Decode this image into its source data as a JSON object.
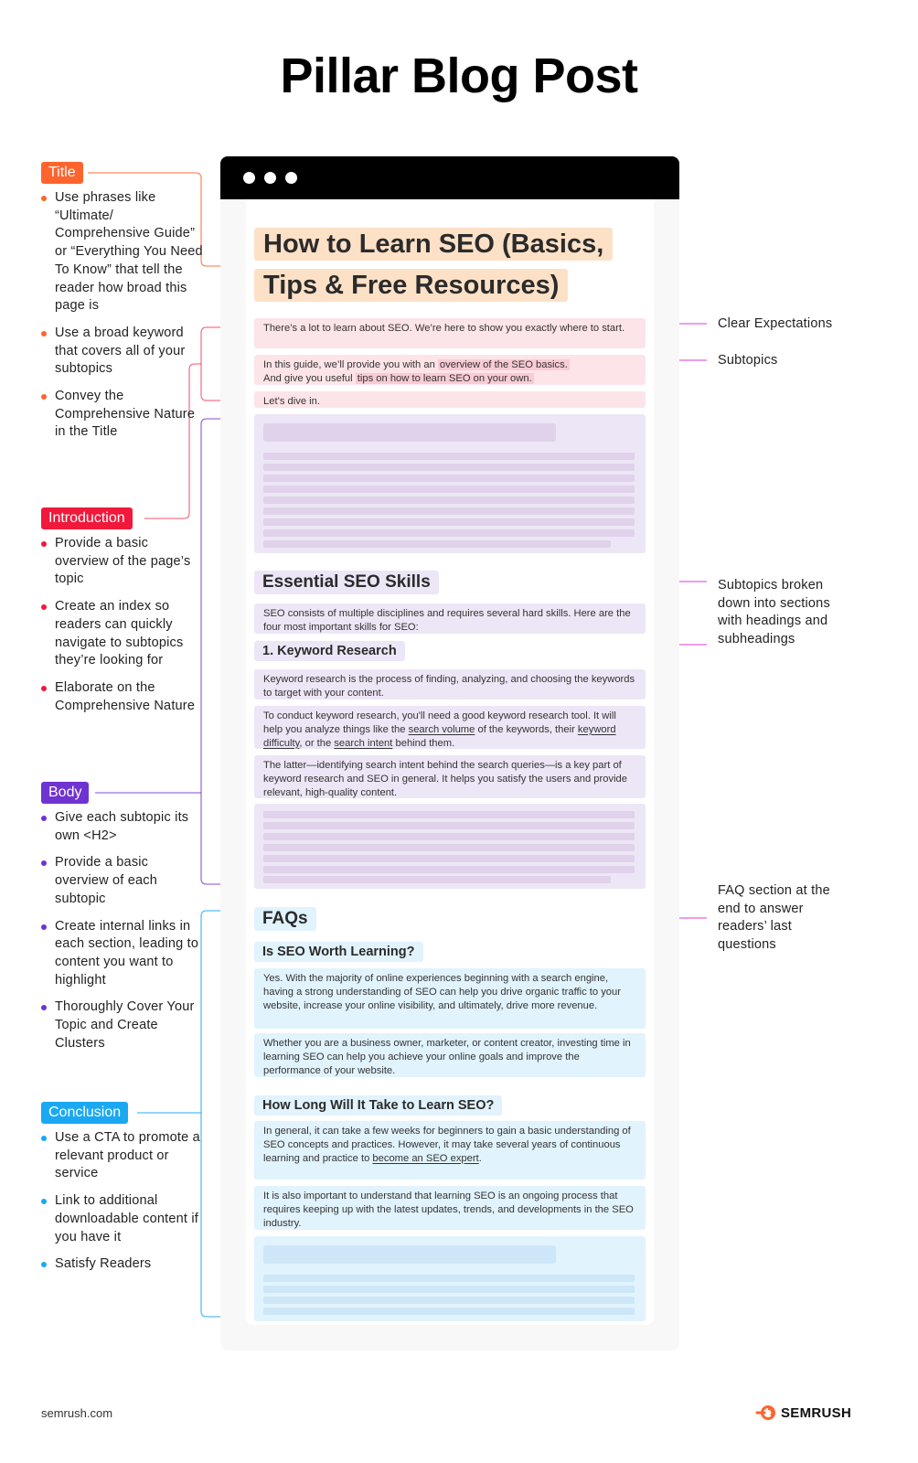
{
  "title": "Pillar Blog Post",
  "colors": {
    "title": "#ff642d",
    "introduction": "#f0193c",
    "body": "#6f33d1",
    "conclusion": "#1ba8f2",
    "annotation": "#d91fd6"
  },
  "left_sections": [
    {
      "badge": "Title",
      "bullets": [
        "Use phrases like “Ultimate/ Comprehensive Guide” or “Everything You Need To Know” that tell the reader how broad this page is",
        "Use a broad keyword that covers all of your subtopics",
        "Convey the Comprehensive Nature in the Title"
      ]
    },
    {
      "badge": "Introduction",
      "bullets": [
        "Provide a basic overview of the page’s topic",
        "Create an index so readers can quickly navigate to subtopics they’re looking for",
        "Elaborate on the Comprehensive Nature"
      ]
    },
    {
      "badge": "Body",
      "bullets": [
        "Give each subtopic its own <H2>",
        "Provide a basic overview of each subtopic",
        "Create internal links in each section, leading to content you want to highlight",
        "Thoroughly Cover Your Topic and Create Clusters"
      ]
    },
    {
      "badge": "Conclusion",
      "bullets": [
        "Use a CTA to promote a relevant product or service",
        "Link to additional downloadable content if you have it",
        "Satisfy Readers"
      ]
    }
  ],
  "article": {
    "title_line1": "How to Learn SEO (Basics,",
    "title_line2": "Tips & Free Resources)",
    "intro_p1": "There’s a lot to learn about SEO. We’re here to show you exactly where to start.",
    "intro_p2_a": "In this guide, we’ll provide you with an ",
    "intro_p2_hl1": "overview of the SEO basics.",
    "intro_p2_b": "And give you useful ",
    "intro_p2_hl2": "tips on how to learn SEO on your own.",
    "intro_p3": "Let’s dive in.",
    "h2_skills": "Essential SEO Skills",
    "skills_p1": "SEO consists of multiple disciplines and requires several hard skills. Here are the four most important skills for SEO:",
    "h3_keyword": "1. Keyword Research",
    "kw_p1": "Keyword research is the process of finding, analyzing, and choosing the keywords to target with your content.",
    "kw_p2_a": "To conduct keyword research, you'll need a good keyword research tool. It will help you analyze things like the ",
    "kw_p2_link1": "search volume",
    "kw_p2_b": " of the keywords, their ",
    "kw_p2_link2": "keyword difficulty",
    "kw_p2_c": ", or the ",
    "kw_p2_link3": "search intent",
    "kw_p2_d": " behind them.",
    "kw_p3": "The latter—identifying search intent behind the search queries—is a key part of keyword research and SEO in general. It helps you satisfy the users and provide relevant, high-quality content.",
    "h2_faqs": "FAQs",
    "h3_faq1": "Is SEO Worth Learning?",
    "faq1_p1": "Yes. With the majority of online experiences beginning with a search engine, having a strong understanding of SEO can help you drive organic traffic to your website, increase your online visibility, and ultimately, drive more revenue.",
    "faq1_p2": "Whether you are a business owner, marketer, or content creator, investing time in learning SEO can help you achieve your online goals and improve the performance of your website.",
    "h3_faq2": "How Long Will It Take to Learn SEO?",
    "faq2_p1_a": "In general, it can take a few weeks for beginners to gain a basic understanding of SEO concepts and practices. However, it may take several years of continuous learning and practice to ",
    "faq2_p1_link": "become an SEO expert",
    "faq2_p1_b": ".",
    "faq2_p2": "It is also important to understand that learning SEO is an ongoing process that requires keeping up with the latest updates, trends, and developments in the SEO industry."
  },
  "annotations": {
    "clear_expectations": "Clear Expectations",
    "subtopics": "Subtopics",
    "subtopics_sections": "Subtopics broken down into sections with headings and subheadings",
    "faq_section": "FAQ section at the end to answer readers’ last questions"
  },
  "footer": {
    "site": "semrush.com",
    "brand": "SEMRUSH",
    "logo_icon": "semrush-fire-logo"
  }
}
